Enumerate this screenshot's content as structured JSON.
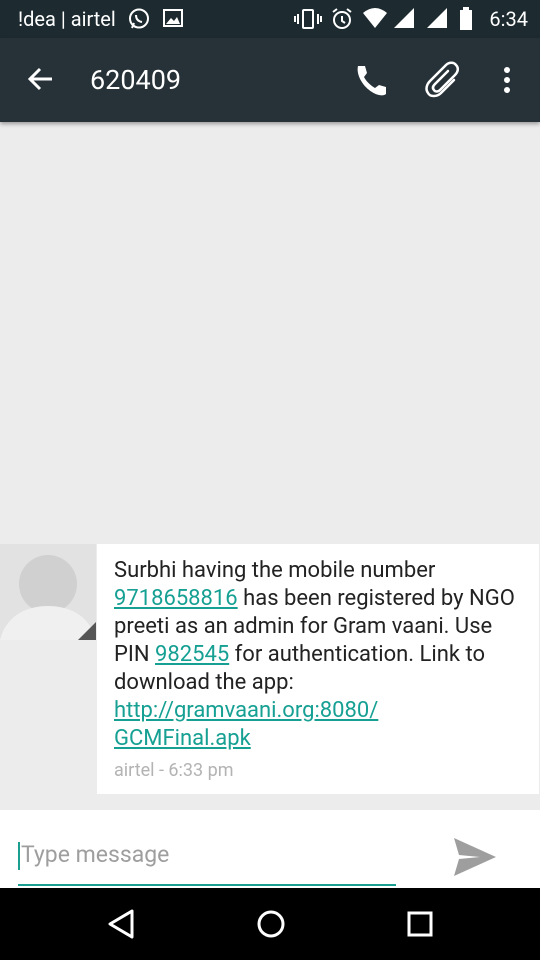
{
  "status_bar": {
    "carrier": "!dea | airtel",
    "time": "6:34",
    "icons": [
      "whatsapp-icon",
      "image-icon",
      "vibrate-icon",
      "alarm-icon",
      "wifi-icon",
      "signal-icon",
      "signal-icon",
      "battery-icon"
    ]
  },
  "toolbar": {
    "title": "620409",
    "icons": [
      "back-arrow-icon",
      "phone-icon",
      "attachment-icon",
      "more-vert-icon"
    ]
  },
  "message": {
    "parts": [
      "Surbhi having the mobile number ",
      "9718658816",
      " has been registered by NGO preeti as an admin for Gram vaani. Use PIN ",
      "982545",
      " for authentication. Link to download the app: ",
      "http://gramvaani.org:8080/ GCMFinal.apk"
    ],
    "meta": "airtel - 6:33 pm",
    "accent_color": "#16a093"
  },
  "compose": {
    "placeholder": "Type message",
    "send_icon": "send-icon"
  },
  "nav_bar": {
    "icons": [
      "back-triangle-icon",
      "home-circle-icon",
      "recents-square-icon"
    ]
  }
}
